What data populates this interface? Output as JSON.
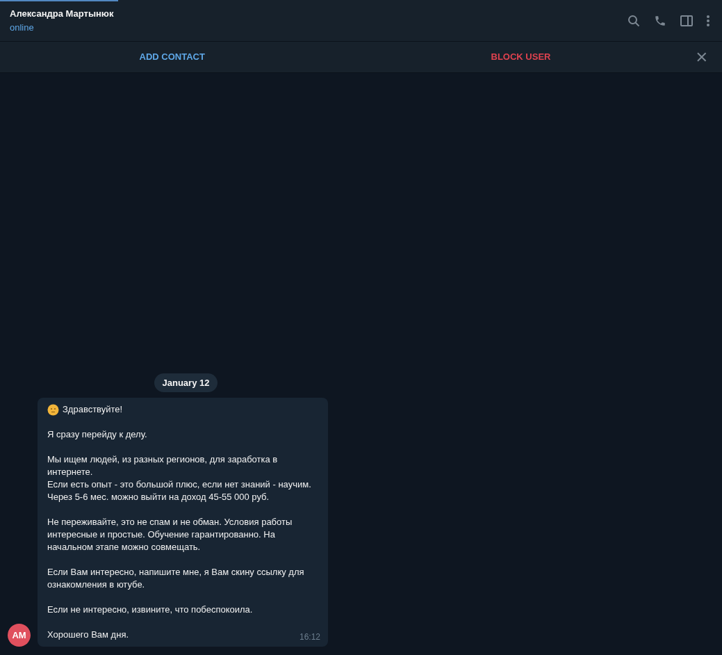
{
  "header": {
    "name": "Александра Мартынюк",
    "status": "online"
  },
  "action_bar": {
    "add_contact": "ADD CONTACT",
    "block_user": "BLOCK USER"
  },
  "date_separator": "January 12",
  "message": {
    "avatar": {
      "initials": "АМ",
      "color": "#e0505e"
    },
    "time": "16:12",
    "has_emoji": true,
    "paragraphs": [
      [
        "Здравствуйте!"
      ],
      [
        "Я сразу перейду к делу."
      ],
      [
        "Мы ищем людей, из разных регионов, для заработка в интернете.",
        "Если есть опыт - это большой плюс, если нет знаний - научим.",
        "Через 5-6 мес. можно выйти на доход 45-55 000 руб."
      ],
      [
        "Не переживайте, это не спам и не обман. Условия работы интересные и простые. Обучение гарантированно. На начальном этапе можно совмещать."
      ],
      [
        "Если Вам интересно, напишите мне, я Вам скину ссылку для ознакомления в ютубе."
      ],
      [
        "Если не интересно, извините, что побеспокоила."
      ],
      [
        "Хорошего Вам дня."
      ]
    ]
  }
}
